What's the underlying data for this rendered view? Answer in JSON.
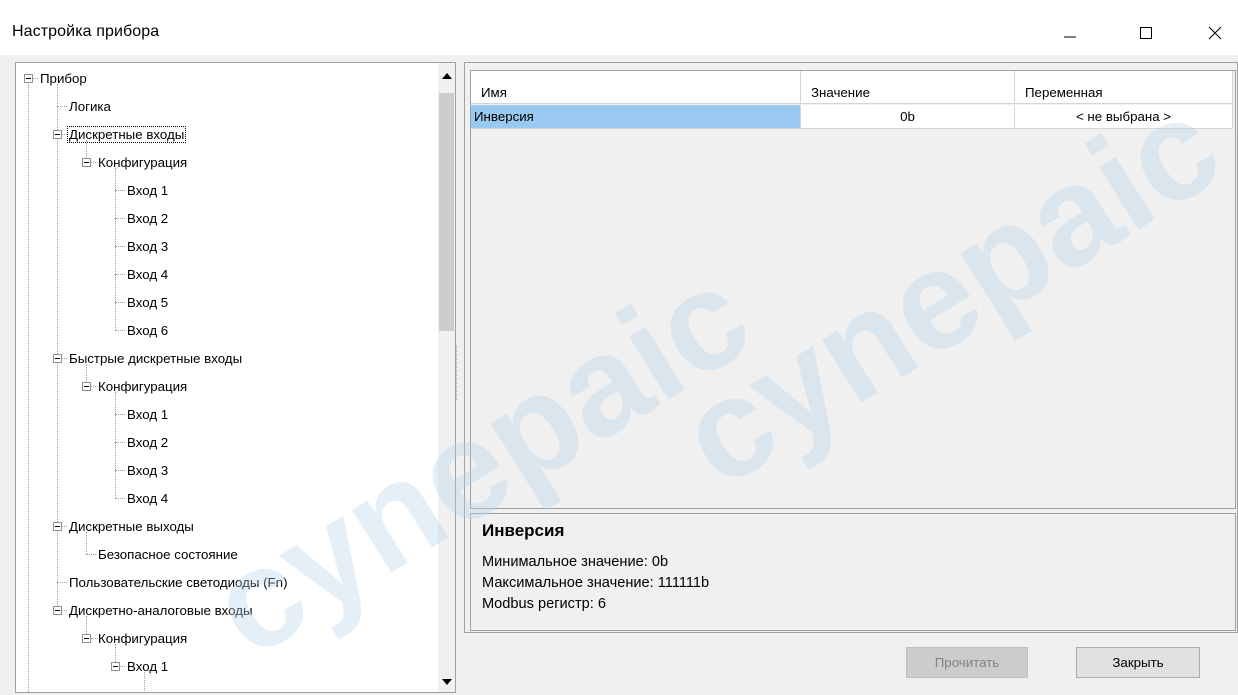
{
  "window": {
    "title": "Настройка прибора",
    "controls": [
      "minimize-icon",
      "maximize-icon",
      "close-icon"
    ]
  },
  "tree": {
    "nodes": [
      {
        "label": "Прибор",
        "level": 0,
        "expander": true
      },
      {
        "label": "Логика",
        "level": 1,
        "expander": false
      },
      {
        "label": "Дискретные входы",
        "level": 1,
        "expander": true,
        "focused": true
      },
      {
        "label": "Конфигурация",
        "level": 2,
        "expander": true
      },
      {
        "label": "Вход 1",
        "level": 3,
        "expander": false
      },
      {
        "label": "Вход 2",
        "level": 3,
        "expander": false
      },
      {
        "label": "Вход 3",
        "level": 3,
        "expander": false
      },
      {
        "label": "Вход 4",
        "level": 3,
        "expander": false
      },
      {
        "label": "Вход 5",
        "level": 3,
        "expander": false
      },
      {
        "label": "Вход 6",
        "level": 3,
        "expander": false
      },
      {
        "label": "Быстрые дискретные входы",
        "level": 1,
        "expander": true
      },
      {
        "label": "Конфигурация",
        "level": 2,
        "expander": true
      },
      {
        "label": "Вход 1",
        "level": 3,
        "expander": false
      },
      {
        "label": "Вход 2",
        "level": 3,
        "expander": false
      },
      {
        "label": "Вход 3",
        "level": 3,
        "expander": false
      },
      {
        "label": "Вход 4",
        "level": 3,
        "expander": false
      },
      {
        "label": "Дискретные выходы",
        "level": 1,
        "expander": true
      },
      {
        "label": "Безопасное состояние",
        "level": 2,
        "expander": false
      },
      {
        "label": "Пользовательские светодиоды (Fn)",
        "level": 1,
        "expander": false
      },
      {
        "label": "Дискретно-аналоговые входы",
        "level": 1,
        "expander": true
      },
      {
        "label": "Конфигурация",
        "level": 2,
        "expander": true
      },
      {
        "label": "Вход 1",
        "level": 3,
        "expander": true
      }
    ]
  },
  "grid": {
    "headers": [
      "Имя",
      "Значение",
      "Переменная"
    ],
    "rows": [
      {
        "name": "Инверсия",
        "value": "0b",
        "variable": "< не выбрана >"
      }
    ]
  },
  "description": {
    "title": "Инверсия",
    "lines": [
      "Минимальное значение: 0b",
      "Максимальное значение: 111111b",
      "Modbus регистр: 6"
    ]
  },
  "buttons": {
    "read_label": "Прочитать",
    "close_label": "Закрыть"
  },
  "watermark": {
    "text": "cynepaic",
    "color": "#b4d2e8"
  }
}
